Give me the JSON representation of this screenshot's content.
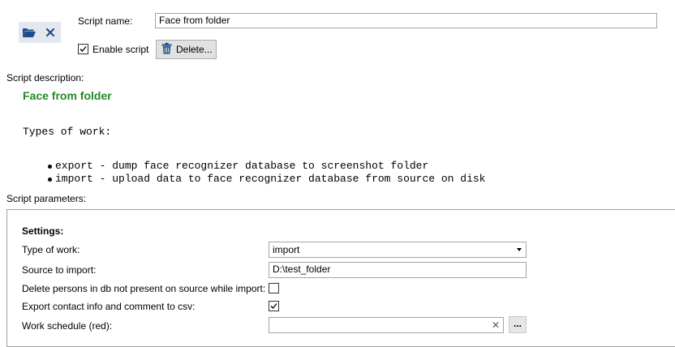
{
  "toolbar": {
    "open_icon": "folder-open-icon",
    "close_icon": "close-icon"
  },
  "header": {
    "script_name_label": "Script name:",
    "script_name_value": "Face from folder",
    "enable_label": "Enable script",
    "enable_checked": true,
    "delete_label": "Delete..."
  },
  "description": {
    "label": "Script description:",
    "title": "Face from folder",
    "types_heading": "Types of work:",
    "items": [
      "export - dump face recognizer database to screenshot folder",
      "import - upload data to face recognizer database from source on disk"
    ]
  },
  "params": {
    "label": "Script parameters:",
    "settings_heading": "Settings:",
    "type_of_work_label": "Type of work:",
    "type_of_work_value": "import",
    "source_label": "Source to import:",
    "source_value": "D:\\test_folder",
    "delete_persons_label": "Delete persons in db not present on source while import:",
    "delete_persons_checked": false,
    "export_contact_label": "Export contact info and comment to csv:",
    "export_contact_checked": true,
    "work_schedule_label": "Work schedule (red):",
    "work_schedule_value": "",
    "clear_icon": "clear-icon",
    "browse_label": "..."
  },
  "colors": {
    "title_green": "#218a21",
    "button_bg": "#e1e1e1",
    "icon_button_bg": "#e4e8ee",
    "icon_blue": "#1f4e8c"
  }
}
